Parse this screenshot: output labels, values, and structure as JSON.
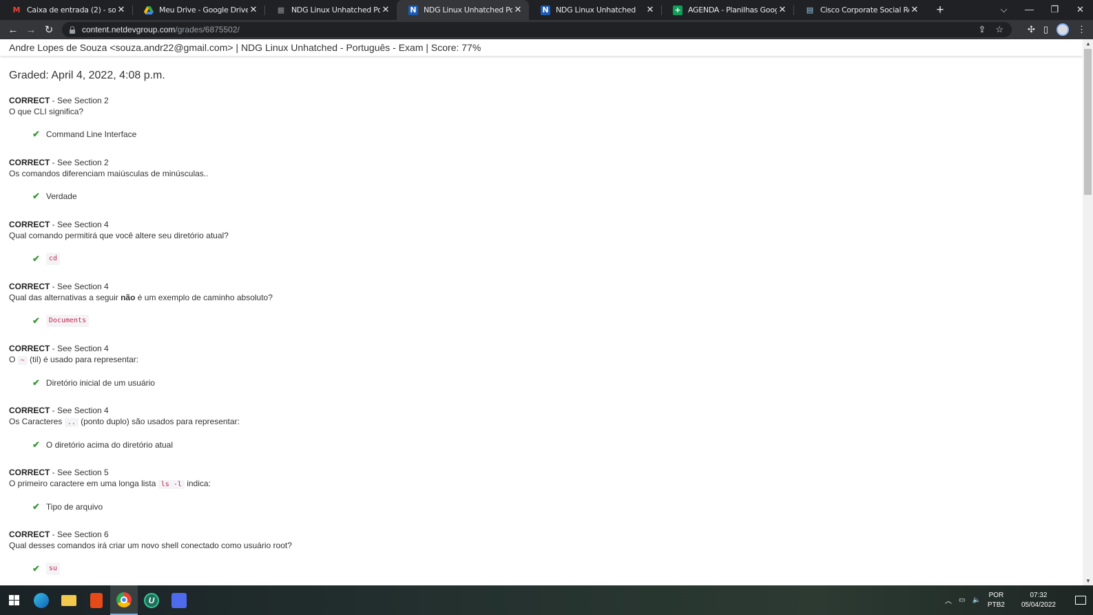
{
  "browser": {
    "tabs": [
      {
        "title": "Caixa de entrada (2) - souza.andr",
        "icon": "gmail-icon",
        "active": false
      },
      {
        "title": "Meu Drive - Google Drive",
        "icon": "google-drive-icon",
        "active": false
      },
      {
        "title": "NDG Linux Unhatched Português",
        "icon": "ndg-icon",
        "active": false
      },
      {
        "title": "NDG Linux Unhatched Português",
        "icon": "ndg-icon",
        "active": true
      },
      {
        "title": "NDG Linux Unhatched",
        "icon": "ndg-icon",
        "active": false
      },
      {
        "title": "AGENDA - Planilhas Google",
        "icon": "google-sheets-icon",
        "active": false
      },
      {
        "title": "Cisco Corporate Social Responsi",
        "icon": "cisco-icon",
        "active": false
      }
    ],
    "url_host": "content.netdevgroup.com",
    "url_path": "/grades/6875502/"
  },
  "page": {
    "header": "Andre Lopes de Souza <souza.andr22@gmail.com> | NDG Linux Unhatched - Português - Exam | Score: 77%",
    "graded": "Graded: April 4, 2022, 4:08 p.m.",
    "status_label": "CORRECT",
    "questions": [
      {
        "section": " - See Section 2",
        "q_parts": [
          "O que CLI significa?"
        ],
        "answer": "Command Line Interface"
      },
      {
        "section": " - See Section 2",
        "q_parts": [
          "Os comandos diferenciam maiúsculas de minúsculas.."
        ],
        "answer": "Verdade"
      },
      {
        "section": " - See Section 4",
        "q_parts": [
          "Qual comando permitirá que você altere seu diretório atual?"
        ],
        "answer_code": "cd"
      },
      {
        "section": " - See Section 4",
        "q_parts": [
          "Qual das alternativas a seguir ",
          "não",
          " é um exemplo de caminho absoluto?"
        ],
        "answer_code": "Documents"
      },
      {
        "section": " - See Section 4",
        "q_parts": [
          "O ",
          "~",
          " (til) é usado para representar:"
        ],
        "answer": "Diretório inicial de um usuário"
      },
      {
        "section": " - See Section 4",
        "q_parts": [
          "Os Caracteres ",
          "..",
          " (ponto duplo) são usados para representar:"
        ],
        "answer": "O diretório acima do diretório atual"
      },
      {
        "section": " - See Section 5",
        "q_parts": [
          "O primeiro caractere em uma longa lista ",
          "ls -l",
          " indica:"
        ],
        "answer": "Tipo de arquivo"
      },
      {
        "section": " - See Section 6",
        "q_parts": [
          "Qual desses comandos irá criar um novo shell conectado como usuário root?"
        ],
        "answer_code": "su"
      }
    ]
  },
  "taskbar": {
    "lang_1": "POR",
    "lang_2": "PTB2",
    "time": "07:32",
    "date": "05/04/2022"
  },
  "colors": {
    "check": "#3c9a3c",
    "code": "#c7254e",
    "tabstrip": "#202124",
    "toolbar": "#35363a"
  }
}
